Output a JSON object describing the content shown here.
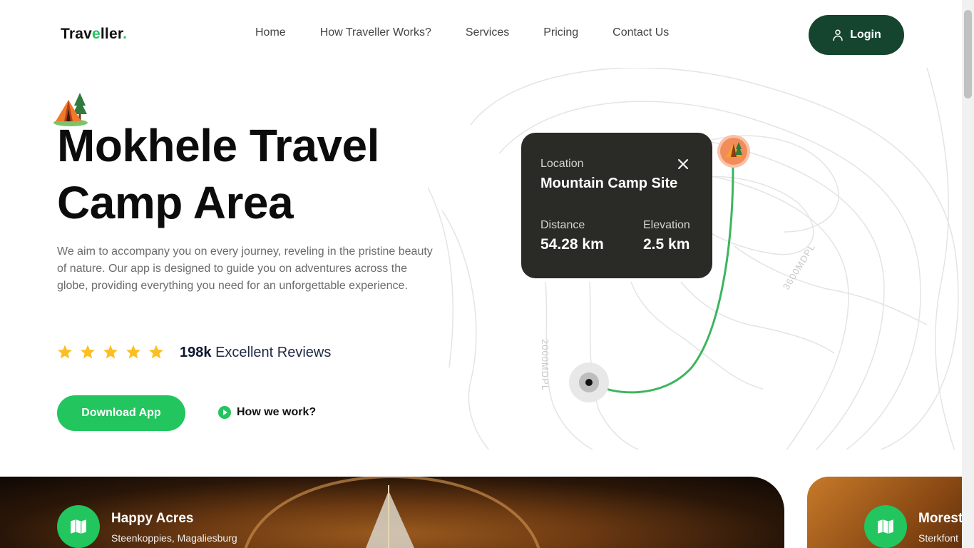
{
  "header": {
    "logo_main": "Trav",
    "logo_accent_e": "e",
    "logo_tail": "ller",
    "logo_dot": ".",
    "nav": [
      "Home",
      "How Traveller Works?",
      "Services",
      "Pricing",
      "Contact Us"
    ],
    "login_label": "Login"
  },
  "hero": {
    "title_line1": "Mokhele Travel",
    "title_line2": "Camp Area",
    "description": "We aim to accompany you on every journey, reveling in the pristine beauty of nature. Our app is designed to guide you on adventures across the globe, providing everything you need for an unforgettable experience.",
    "rating_stars": 5,
    "reviews_count": "198k",
    "reviews_label": "Excellent Reviews",
    "download_label": "Download App",
    "how_label": "How we work?"
  },
  "map": {
    "location_label": "Location",
    "location_value": "Mountain Camp Site",
    "distance_label": "Distance",
    "distance_value": "54.28 km",
    "elevation_label": "Elevation",
    "elevation_value": "2.5 km",
    "contour_label_1": "2000MDPL",
    "contour_label_2": "3600MDPL"
  },
  "cards": [
    {
      "title": "Happy Acres",
      "subtitle": "Steenkoppies, Magaliesburg"
    },
    {
      "title": "Morest",
      "subtitle": "Sterkfont"
    }
  ],
  "colors": {
    "accent": "#22c55e",
    "login_bg": "#16452f",
    "card_bg": "#2a2a26",
    "star": "#fbbf24",
    "pin": "#f28c5a"
  },
  "icons": {
    "login": "user-icon",
    "close": "close-icon",
    "play": "play-icon",
    "card_badge": "map-icon",
    "star": "star-icon",
    "pin": "tent-pin-icon",
    "tent": "tent-icon"
  }
}
